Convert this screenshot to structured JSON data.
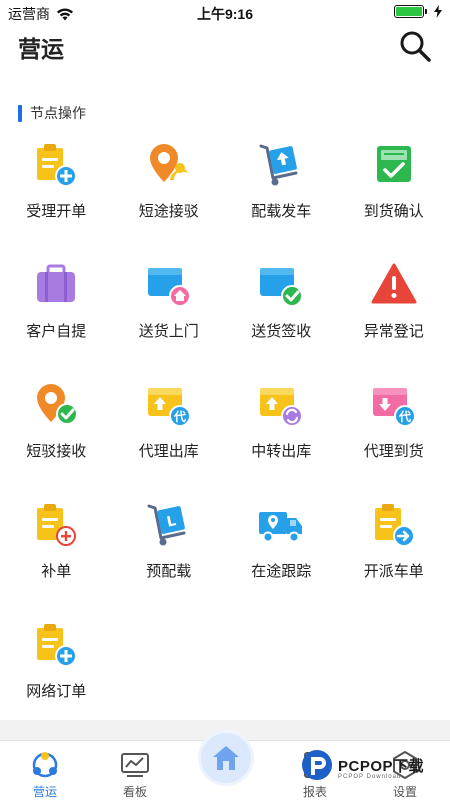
{
  "status_bar": {
    "carrier": "运营商",
    "time": "上午9:16"
  },
  "header": {
    "title": "营运"
  },
  "section": {
    "title": "节点操作"
  },
  "grid": {
    "items": [
      {
        "label": "受理开单"
      },
      {
        "label": "短途接驳"
      },
      {
        "label": "配载发车"
      },
      {
        "label": "到货确认"
      },
      {
        "label": "客户自提"
      },
      {
        "label": "送货上门"
      },
      {
        "label": "送货签收"
      },
      {
        "label": "异常登记"
      },
      {
        "label": "短驳接收"
      },
      {
        "label": "代理出库"
      },
      {
        "label": "中转出库"
      },
      {
        "label": "代理到货"
      },
      {
        "label": "补单"
      },
      {
        "label": "预配载"
      },
      {
        "label": "在途跟踪"
      },
      {
        "label": "开派车单"
      },
      {
        "label": "网络订单"
      }
    ]
  },
  "tabs": [
    {
      "label": "营运"
    },
    {
      "label": "看板"
    },
    {
      "label": "报表"
    },
    {
      "label": "设置"
    }
  ],
  "watermark": {
    "text": "PCPOP下载",
    "sub": "PCPOP Download"
  },
  "colors": {
    "accent": "#2a7ae2",
    "yellow": "#f7c21a",
    "orange": "#f08a28",
    "blue": "#26a0e8",
    "green": "#2cb84f",
    "purple": "#a87be0",
    "red": "#e8453a",
    "pink": "#f26ba2"
  }
}
